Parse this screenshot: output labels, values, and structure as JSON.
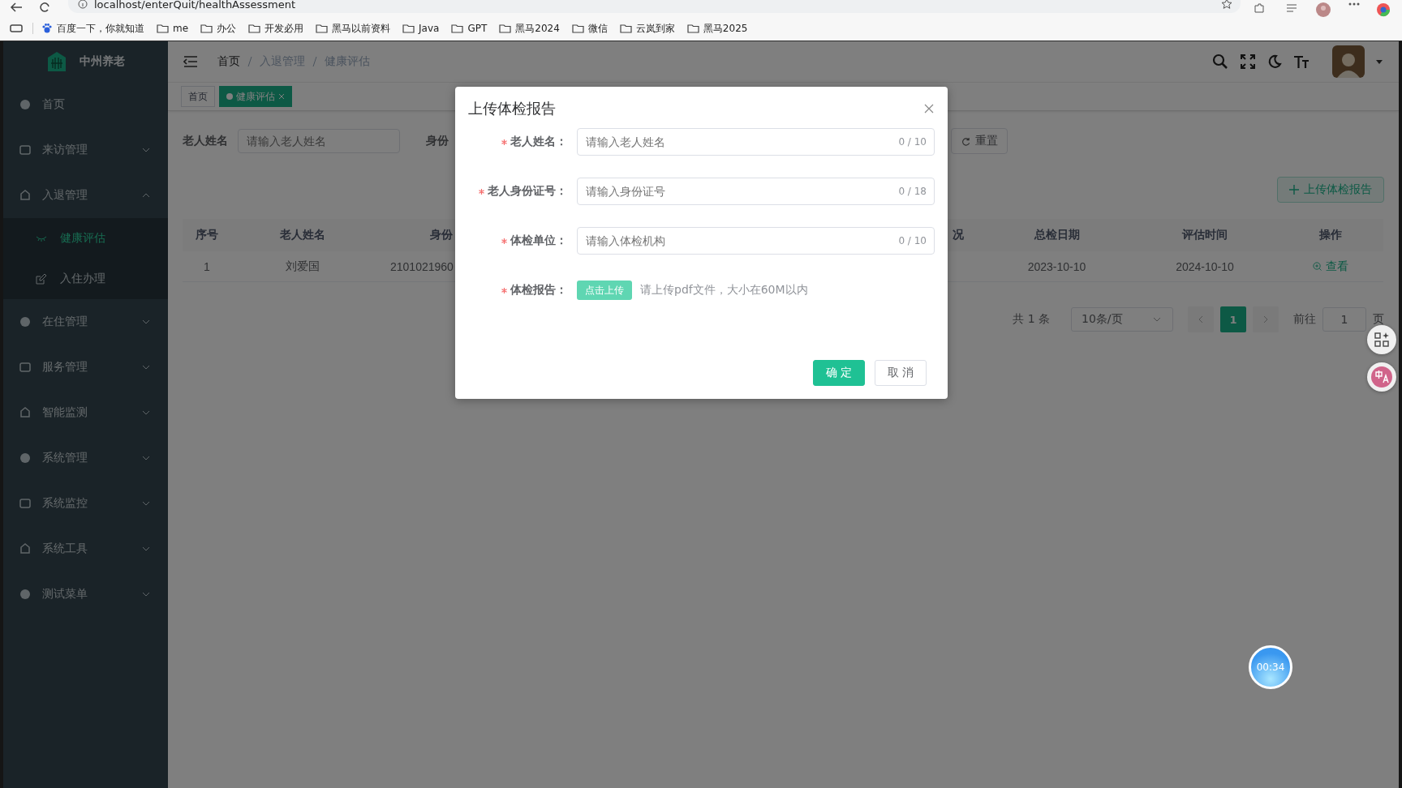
{
  "browser": {
    "url": "localhost/enterQuit/healthAssessment",
    "bookmarks": [
      "百度一下，你就知道",
      "me",
      "办公",
      "开发必用",
      "黑马以前资料",
      "Java",
      "GPT",
      "黑马2024",
      "微信",
      "云岚到家",
      "黑马2025"
    ]
  },
  "sidebar": {
    "brand": "中州养老",
    "items": [
      {
        "label": "首页"
      },
      {
        "label": "来访管理",
        "expanded": false
      },
      {
        "label": "入退管理",
        "expanded": true,
        "children": [
          {
            "label": "健康评估",
            "selected": true
          },
          {
            "label": "入住办理",
            "selected": false
          }
        ]
      },
      {
        "label": "在住管理",
        "expanded": false
      },
      {
        "label": "服务管理",
        "expanded": false
      },
      {
        "label": "智能监测",
        "expanded": false
      },
      {
        "label": "系统管理",
        "expanded": false
      },
      {
        "label": "系统监控",
        "expanded": false
      },
      {
        "label": "系统工具",
        "expanded": false
      },
      {
        "label": "测试菜单",
        "expanded": false
      }
    ]
  },
  "breadcrumb": [
    "首页",
    "入退管理",
    "健康评估"
  ],
  "tags": [
    {
      "label": "首页",
      "selected": false
    },
    {
      "label": "健康评估",
      "selected": true
    }
  ],
  "search": {
    "fields": [
      {
        "label": "老人姓名",
        "placeholder": "请输入老人姓名"
      },
      {
        "label": "身份"
      }
    ],
    "reset_button": "重置"
  },
  "upload_button": "上传体检报告",
  "table": {
    "columns": [
      "序号",
      "老人姓名",
      "身份",
      "况",
      "总检日期",
      "评估时间",
      "操作"
    ],
    "rows": [
      {
        "cells": [
          "1",
          "刘爱国",
          "2101021960",
          "",
          "2023-10-10",
          "2024-10-10",
          "查看"
        ]
      }
    ]
  },
  "pagination": {
    "total": "共 1 条",
    "page_size": "10条/页",
    "pages": [
      {
        "label": "1",
        "selected": true
      }
    ],
    "goto_label": "前往",
    "goto_value": "1",
    "page_suffix": "页"
  },
  "timer": "00:34",
  "modal": {
    "title": "上传体检报告",
    "fields": [
      {
        "kind": "input",
        "label": "老人姓名：",
        "required": true,
        "placeholder": "请输入老人姓名",
        "counter": "0 / 10"
      },
      {
        "kind": "input",
        "label": "老人身份证号：",
        "required": true,
        "placeholder": "请输入身份证号",
        "counter": "0 / 18"
      },
      {
        "kind": "input",
        "label": "体检单位：",
        "required": true,
        "placeholder": "请输入体检机构",
        "counter": "0 / 10"
      },
      {
        "kind": "upload",
        "label": "体检报告：",
        "required": true,
        "button": "点击上传",
        "hint": "请上传pdf文件，大小在60M以内"
      }
    ],
    "buttons": [
      {
        "label": "确 定",
        "kind": "primary"
      },
      {
        "label": "取 消",
        "kind": "default"
      }
    ]
  }
}
